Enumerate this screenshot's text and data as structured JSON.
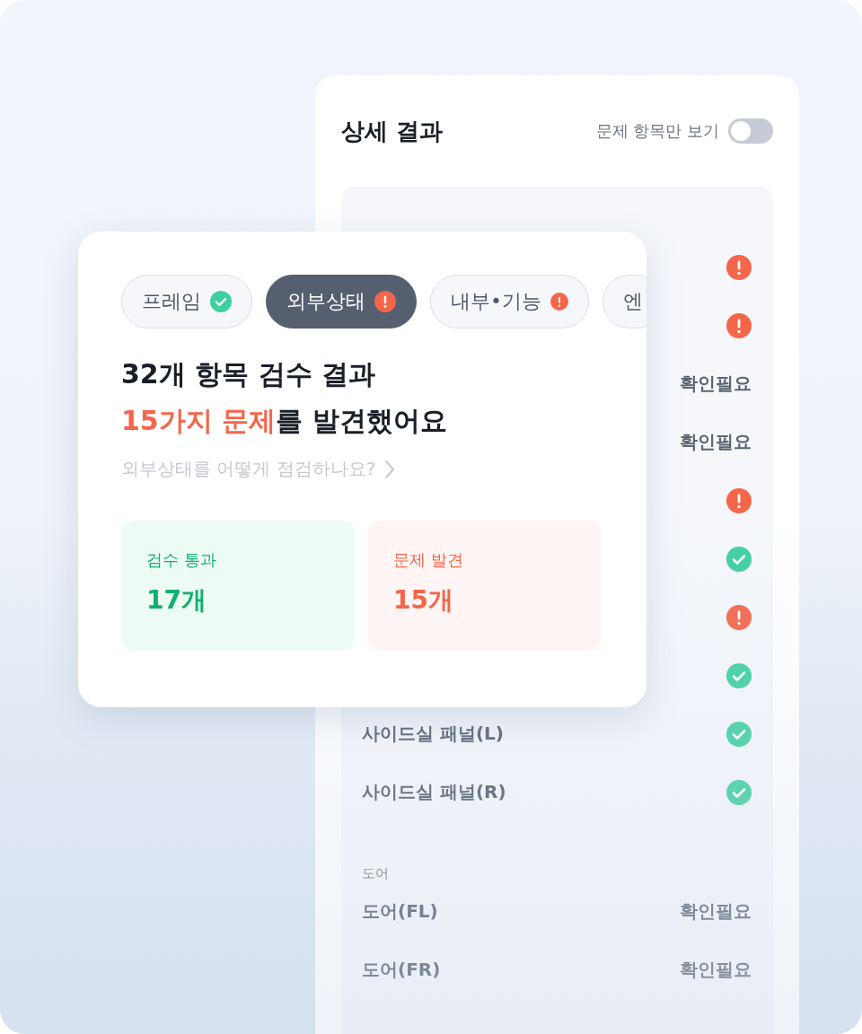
{
  "detail_panel": {
    "title": "상세 결과",
    "filter_toggle": {
      "label": "문제 항목만 보기",
      "on": false
    },
    "groups": [
      {
        "rows": [
          {
            "kind": "issue"
          },
          {
            "kind": "issue"
          },
          {
            "kind": "check",
            "status_text": "확인필요"
          },
          {
            "kind": "check",
            "status_text": "확인필요"
          },
          {
            "kind": "issue"
          },
          {
            "kind": "pass"
          },
          {
            "kind": "issue"
          },
          {
            "kind": "pass"
          },
          {
            "name": "사이드실 패널(L)",
            "kind": "pass"
          },
          {
            "name": "사이드실 패널(R)",
            "kind": "pass"
          }
        ]
      },
      {
        "label": "도어",
        "rows": [
          {
            "name": "도어(FL)",
            "kind": "check",
            "status_text": "확인필요"
          },
          {
            "name": "도어(FR)",
            "kind": "check",
            "status_text": "확인필요"
          }
        ]
      }
    ]
  },
  "summary_card": {
    "tabs": [
      {
        "label": "프레임",
        "kind": "pass",
        "selected": false
      },
      {
        "label": "외부상태",
        "kind": "issue",
        "selected": true
      },
      {
        "label": "내부•기능",
        "kind": "issue",
        "selected": false
      },
      {
        "label": "엔",
        "selected": false
      }
    ],
    "headline": "32개 항목 검수 결과",
    "subline": {
      "accent": "15가지 문제",
      "rest": "를 발견했어요"
    },
    "help_link": "외부상태를 어떻게 점검하나요?",
    "stats": [
      {
        "kind": "pass",
        "label": "검수 통과",
        "value": "17개"
      },
      {
        "kind": "issue",
        "label": "문제 발견",
        "value": "15개"
      }
    ]
  }
}
